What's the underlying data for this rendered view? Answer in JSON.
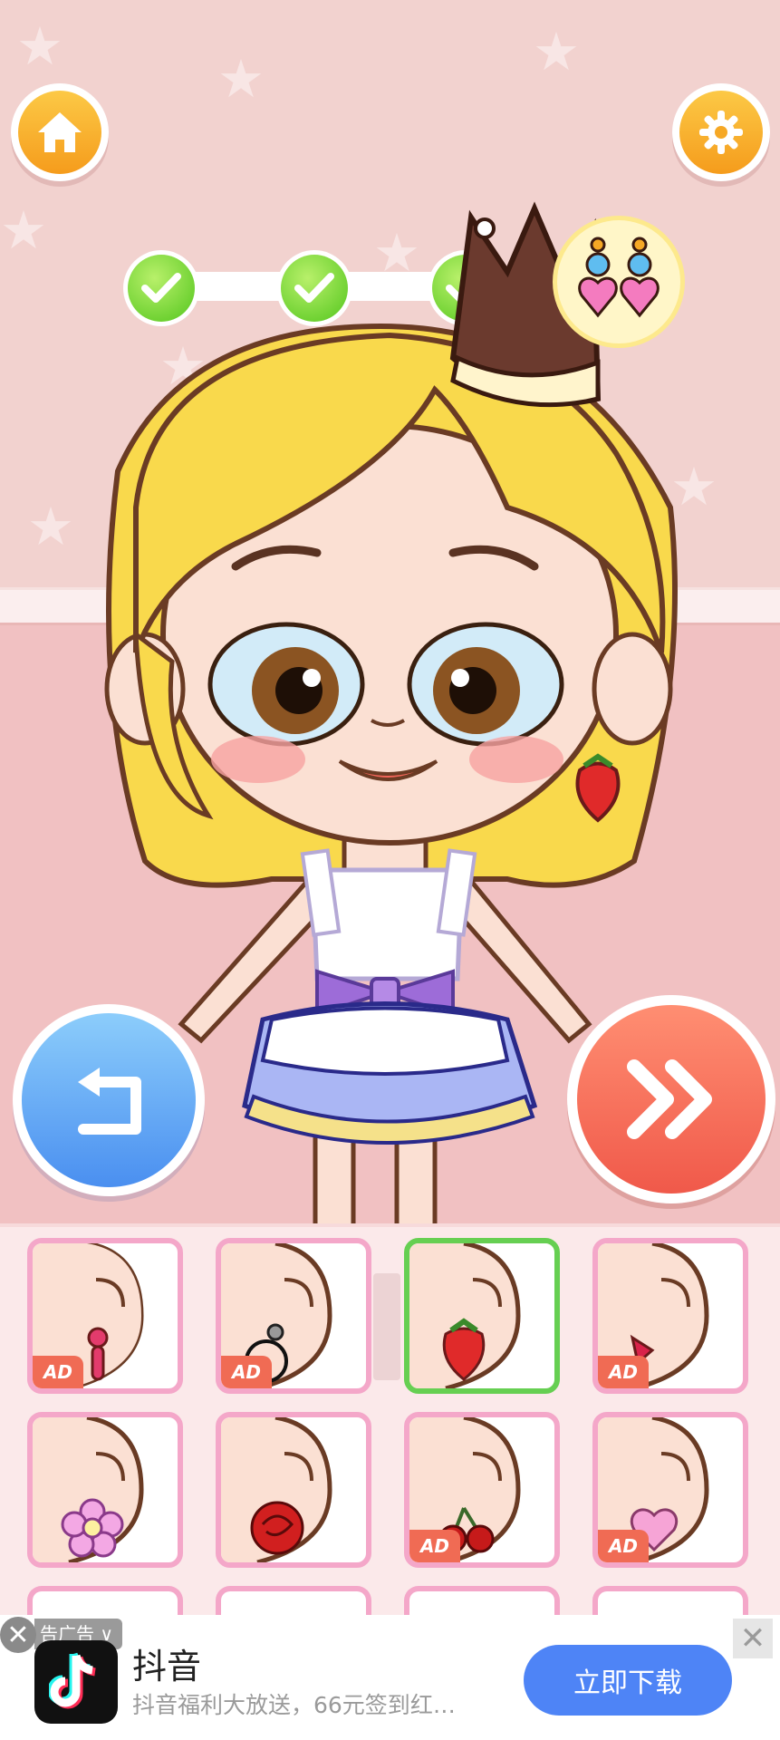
{
  "toolbar": {
    "home_icon": "home-icon",
    "settings_icon": "gear-icon"
  },
  "progress": {
    "completed_steps": 3,
    "current_step_icon": "earrings-icon"
  },
  "actions": {
    "undo_icon": "undo-icon",
    "next_icon": "fast-forward-icon"
  },
  "items": [
    {
      "name": "earring-pink-drop",
      "ad": true,
      "selected": false,
      "ad_label": "AD"
    },
    {
      "name": "earring-black-hoop",
      "ad": true,
      "selected": false,
      "ad_label": "AD"
    },
    {
      "name": "earring-strawberry",
      "ad": false,
      "selected": true
    },
    {
      "name": "earring-red-stud",
      "ad": true,
      "selected": false,
      "ad_label": "AD"
    },
    {
      "name": "earring-pink-flower",
      "ad": false,
      "selected": false
    },
    {
      "name": "earring-red-rose",
      "ad": false,
      "selected": false
    },
    {
      "name": "earring-cherry",
      "ad": true,
      "selected": false,
      "ad_label": "AD"
    },
    {
      "name": "earring-pink-heart",
      "ad": true,
      "selected": false,
      "ad_label": "AD"
    }
  ],
  "ad_banner": {
    "tag": "告广告 ∨",
    "app_name": "抖音",
    "description": "抖音福利大放送，66元签到红…",
    "cta": "立即下载",
    "close_symbol": "✕"
  },
  "colors": {
    "accent_green": "#66cf52",
    "tile_border": "#f4a7c9",
    "next_red": "#f0594a",
    "undo_blue": "#4a8ff0",
    "cta_blue": "#4e84f6"
  }
}
